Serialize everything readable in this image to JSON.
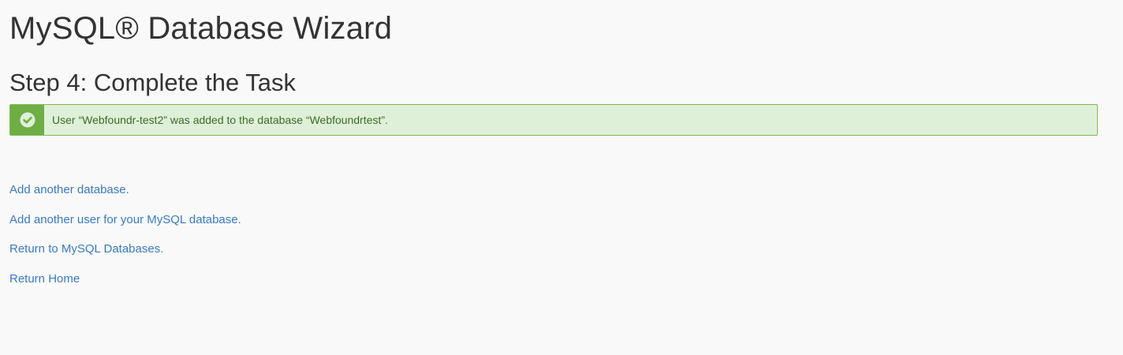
{
  "page": {
    "title": "MySQL® Database Wizard",
    "step_heading": "Step 4: Complete the Task"
  },
  "alert": {
    "type": "success",
    "icon": "check-circle-icon",
    "message": "User “Webfoundr-test2” was added to the database “Webfoundrtest”.",
    "colors": {
      "icon_background": "#6fae44",
      "background": "#dff0d8",
      "border": "#7fb855",
      "text": "#3c6b2a"
    }
  },
  "links": [
    {
      "label": "Add another database."
    },
    {
      "label": "Add another user for your MySQL database."
    },
    {
      "label": "Return to MySQL Databases."
    },
    {
      "label": "Return Home"
    }
  ],
  "colors": {
    "link": "#3a7bbf",
    "background": "#f9f9f9",
    "heading": "#333333"
  }
}
